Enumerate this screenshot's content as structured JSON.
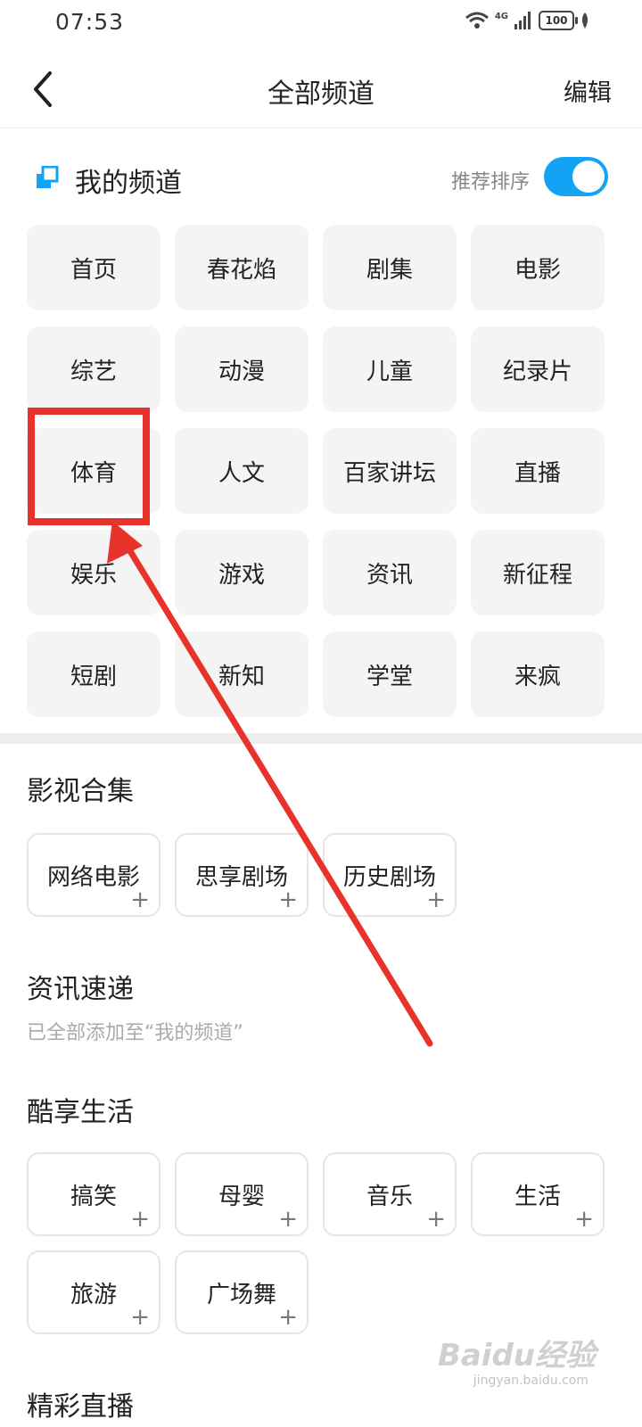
{
  "status_bar": {
    "time": "07:53",
    "network": "4G",
    "battery": "100"
  },
  "nav": {
    "title": "全部频道",
    "edit_label": "编辑"
  },
  "my_channels": {
    "title": "我的频道",
    "sort_label": "推荐排序",
    "sort_enabled": true,
    "items": [
      "首页",
      "春花焰",
      "剧集",
      "电影",
      "综艺",
      "动漫",
      "儿童",
      "纪录片",
      "体育",
      "人文",
      "百家讲坛",
      "直播",
      "娱乐",
      "游戏",
      "资讯",
      "新征程",
      "短剧",
      "新知",
      "学堂",
      "来疯"
    ]
  },
  "sections": [
    {
      "title": "影视合集",
      "items": [
        "网络电影",
        "思享剧场",
        "历史剧场"
      ]
    },
    {
      "title": "资讯速递",
      "subtitle": "已全部添加至“我的频道”",
      "items": []
    },
    {
      "title": "酷享生活",
      "items": [
        "搞笑",
        "母婴",
        "音乐",
        "生活",
        "旅游",
        "广场舞"
      ]
    },
    {
      "title": "精彩直播"
    }
  ],
  "annotation": {
    "highlight_item": "体育",
    "color": "#e8332c"
  },
  "watermark": {
    "text": "Baidu经验",
    "sub": "jingyan.baidu.com"
  },
  "colors": {
    "accent": "#13a2f4",
    "tile_bg": "#f4f4f4"
  }
}
